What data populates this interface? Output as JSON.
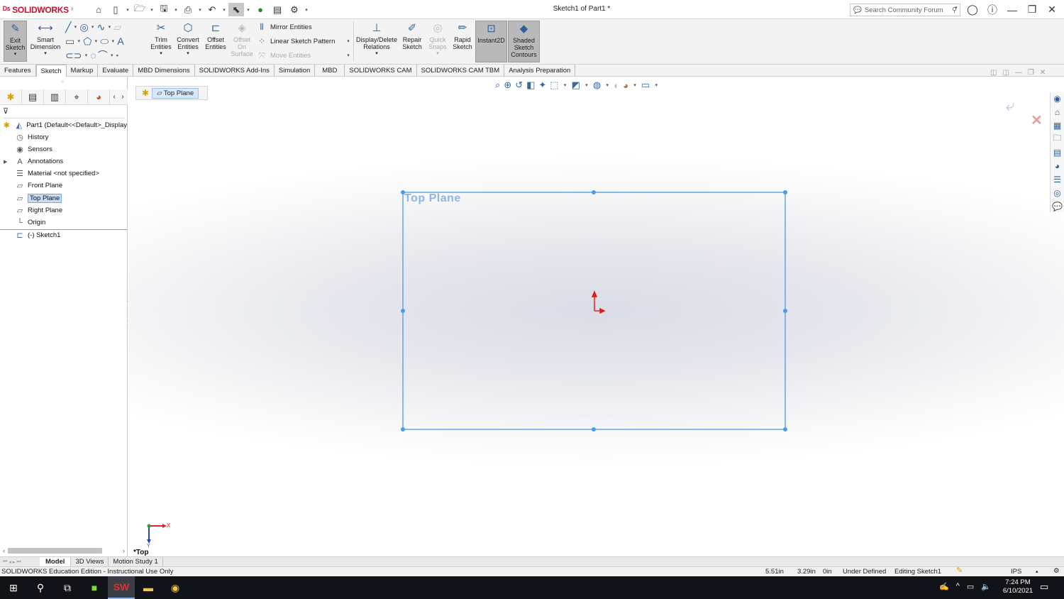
{
  "app": {
    "brand": "SOLIDWORKS",
    "document_title": "Sketch1 of Part1 *"
  },
  "search": {
    "placeholder": "Search Community Forum"
  },
  "ribbon": {
    "exit_sketch": "Exit Sketch",
    "smart_dimension": "Smart Dimension",
    "trim_entities": "Trim Entities",
    "convert_entities": "Convert Entities",
    "offset_entities": "Offset Entities",
    "offset_on_surface": "Offset On Surface",
    "mirror_entities": "Mirror Entities",
    "linear_sketch_pattern": "Linear Sketch Pattern",
    "move_entities": "Move Entities",
    "display_delete_relations": "Display/Delete Relations",
    "repair_sketch": "Repair Sketch",
    "quick_snaps": "Quick Snaps",
    "rapid_sketch": "Rapid Sketch",
    "instant2d": "Instant2D",
    "shaded_sketch_contours": "Shaded Sketch Contours"
  },
  "tabs": [
    "Features",
    "Sketch",
    "Markup",
    "Evaluate",
    "MBD Dimensions",
    "SOLIDWORKS Add-Ins",
    "Simulation",
    "MBD",
    "SOLIDWORKS CAM",
    "SOLIDWORKS CAM TBM",
    "Analysis Preparation"
  ],
  "tree": {
    "part": "Part1  (Default<<Default>_Display",
    "history": "History",
    "sensors": "Sensors",
    "annotations": "Annotations",
    "material": "Material <not specified>",
    "front_plane": "Front Plane",
    "top_plane": "Top Plane",
    "right_plane": "Right Plane",
    "origin": "Origin",
    "sketch1": "(-) Sketch1"
  },
  "breadcrumb": {
    "item": "Top Plane"
  },
  "viewport": {
    "plane_label": "Top Plane",
    "view_label": "*Top",
    "axis_x": "X",
    "axis_y": "Y"
  },
  "bottom_tabs": [
    "Model",
    "3D Views",
    "Motion Study 1"
  ],
  "status": {
    "edition": "SOLIDWORKS Education Edition - Instructional Use Only",
    "x": "5.51in",
    "y": "3.29in",
    "z": "0in",
    "state": "Under Defined",
    "editing": "Editing Sketch1",
    "units": "IPS"
  },
  "clock": {
    "time": "7:24 PM",
    "date": "6/10/2021"
  },
  "colors": {
    "sketch_blue": "#4a9be8",
    "origin_red": "#e01818",
    "brand_red": "#c8102e"
  }
}
